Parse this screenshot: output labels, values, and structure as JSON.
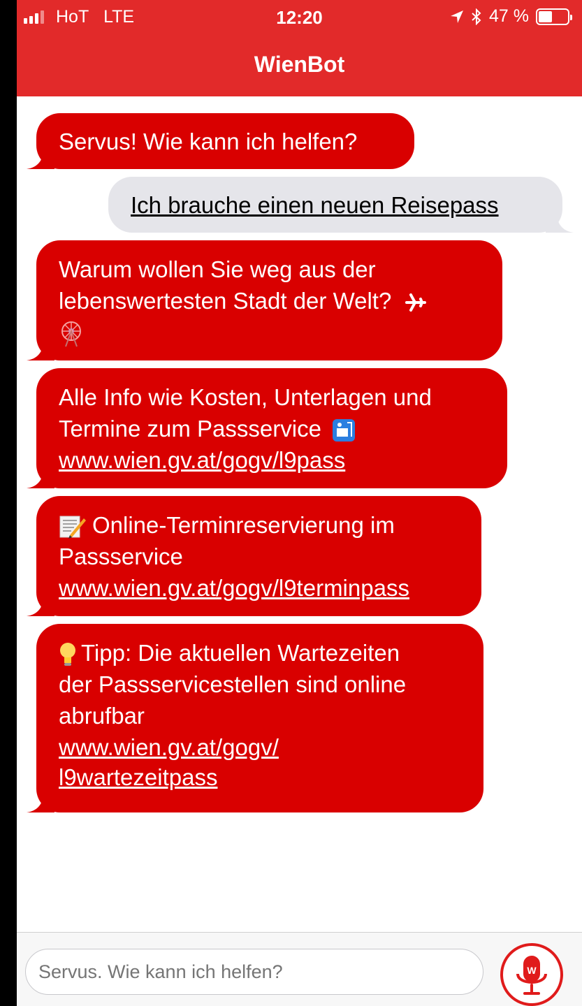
{
  "status_bar": {
    "carrier": "HoT",
    "network": "LTE",
    "time": "12:20",
    "battery_percent": "47 %",
    "battery_level": 0.47
  },
  "header": {
    "title": "WienBot"
  },
  "messages": [
    {
      "from": "bot",
      "lines": [
        "Servus! Wie kann ich helfen?"
      ]
    },
    {
      "from": "user",
      "text": "Ich brauche einen neuen Reisepass"
    },
    {
      "from": "bot",
      "lines": [
        "Warum wollen Sie weg aus der",
        "lebenswertesten Stadt der Welt?"
      ]
    },
    {
      "from": "bot",
      "lines": [
        "Alle Info wie Kosten, Unterlagen und",
        "Termine zum Passservice"
      ],
      "link": "www.wien.gv.at/gogv/l9pass"
    },
    {
      "from": "bot",
      "lines": [
        "Online-Terminreservierung im",
        "Passservice"
      ],
      "link": "www.wien.gv.at/gogv/l9terminpass"
    },
    {
      "from": "bot",
      "lines": [
        "Tipp: Die aktuellen Wartezeiten",
        "der Passservicestellen sind online",
        "abrufbar"
      ],
      "link_lines": [
        "www.wien.gv.at/gogv/",
        "l9wartezeitpass"
      ]
    }
  ],
  "input": {
    "placeholder": "Servus. Wie kann ich helfen?"
  },
  "colors": {
    "header": "#e22a2a",
    "bot_bubble": "#d90000",
    "user_bubble": "#e5e5ea"
  },
  "icons": [
    "signal-icon",
    "location-arrow-icon",
    "bluetooth-icon",
    "battery-icon",
    "airplane-emoji",
    "ferris-wheel-emoji",
    "passport-control-emoji",
    "memo-emoji",
    "light-bulb-emoji",
    "microphone-icon"
  ]
}
